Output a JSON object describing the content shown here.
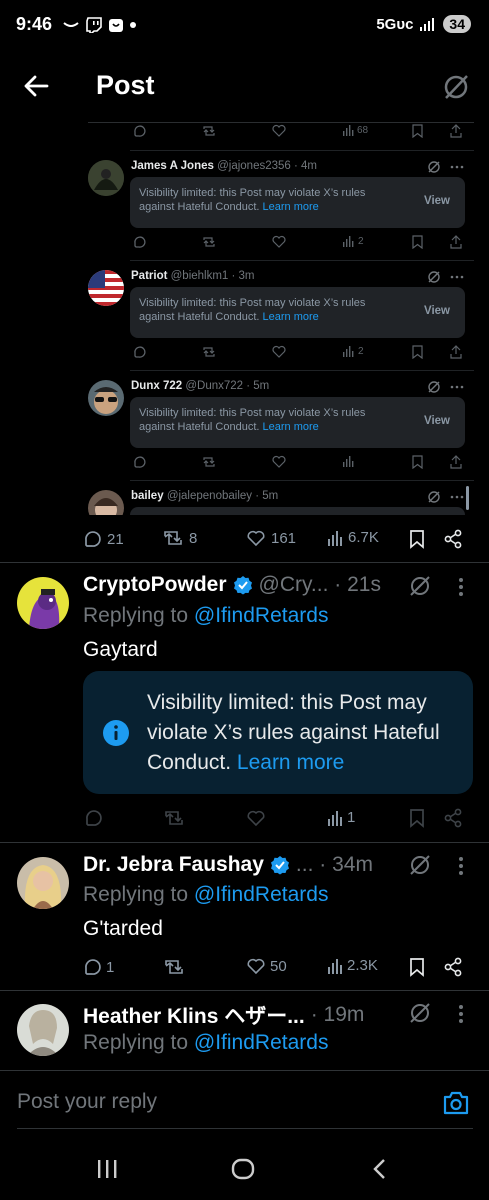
{
  "status_bar": {
    "time": "9:46",
    "network": "5Gᴜᴄ",
    "battery": "34"
  },
  "header": {
    "title": "Post"
  },
  "embedded_thread": {
    "top_stats": {
      "views": "68"
    },
    "posts": [
      {
        "name": "James A Jones",
        "handle": "@jajones2356 · 4m",
        "notice": "Visibility limited: this Post may violate X’s rules against Hateful Conduct.",
        "learn_more": "Learn more",
        "view": "View",
        "views": "2"
      },
      {
        "name": "Patriot",
        "handle": "@biehlkm1 · 3m",
        "notice": "Visibility limited: this Post may violate X’s rules against Hateful Conduct.",
        "learn_more": "Learn more",
        "view": "View",
        "views": "2"
      },
      {
        "name": "Dunx 722",
        "handle": "@Dunx722 · 5m",
        "notice": "Visibility limited: this Post may violate X’s rules against Hateful Conduct.",
        "learn_more": "Learn more",
        "view": "View",
        "views": ""
      },
      {
        "name": "bailey",
        "handle": "@jalepenobailey · 5m"
      }
    ]
  },
  "main_actions": {
    "replies": "21",
    "reposts": "8",
    "likes": "161",
    "views": "6.7K"
  },
  "replies": [
    {
      "name": "CryptoPowder",
      "handle": "@Cry... · 21s",
      "replying_prefix": "Replying to ",
      "replying_to": "@IfindRetards",
      "text": "Gaytard",
      "notice": "Visibility limited: this Post may violate X’s rules against Hateful Conduct.",
      "learn_more": "Learn more",
      "views": "1"
    },
    {
      "name": "Dr. Jebra Faushay",
      "handle": "... · 34m",
      "replying_prefix": "Replying to ",
      "replying_to": "@IfindRetards",
      "text": "G'tarded",
      "replies": "1",
      "likes": "50",
      "views": "2.3K"
    },
    {
      "name": "Heather Klins ヘザー...",
      "handle": "· 19m",
      "replying_prefix": "Replying to ",
      "replying_to": "@IfindRetards"
    }
  ],
  "reply_box": {
    "placeholder": "Post your reply"
  },
  "colors": {
    "accent": "#1d9bf0",
    "background": "#000000",
    "notice_bg": "#082131"
  }
}
